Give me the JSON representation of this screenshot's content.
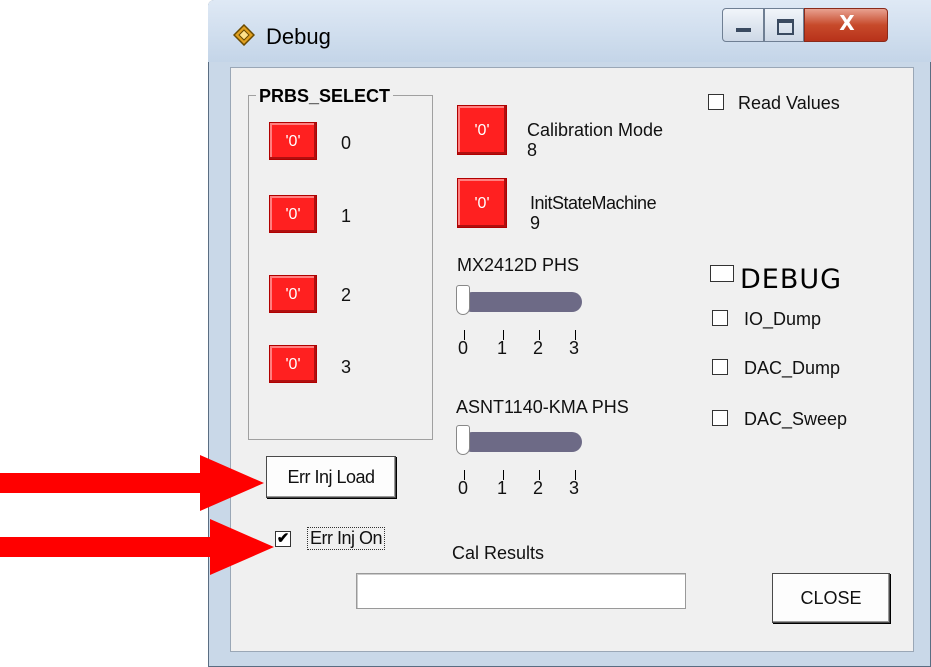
{
  "window": {
    "title": "Debug",
    "close_glyph": "X"
  },
  "prbs_select": {
    "label": "PRBS_SELECT",
    "items": [
      {
        "button_label": "'0'",
        "bit": "0"
      },
      {
        "button_label": "'0'",
        "bit": "1"
      },
      {
        "button_label": "'0'",
        "bit": "2"
      },
      {
        "button_label": "'0'",
        "bit": "3"
      }
    ]
  },
  "calibration": {
    "button_label": "'0'",
    "label": "Calibration Mode",
    "bit": "8"
  },
  "init_state": {
    "button_label": "'0'",
    "label": "InitStateMachine",
    "bit": "9"
  },
  "slider1": {
    "label": "MX2412D PHS",
    "value": 0,
    "ticks": [
      "0",
      "1",
      "2",
      "3"
    ]
  },
  "slider2": {
    "label": "ASNT1140-KMA PHS",
    "value": 0,
    "ticks": [
      "0",
      "1",
      "2",
      "3"
    ]
  },
  "read_values": {
    "label": "Read Values",
    "checked": false
  },
  "debug": {
    "label": "DEBUG",
    "checked": false,
    "options": [
      {
        "label": "IO_Dump",
        "checked": false
      },
      {
        "label": "DAC_Dump",
        "checked": false
      },
      {
        "label": "DAC_Sweep",
        "checked": false
      }
    ]
  },
  "err_inj_load": {
    "label": "Err Inj Load"
  },
  "err_inj_on": {
    "label": "Err Inj On",
    "checked": true,
    "check_glyph": "✔"
  },
  "cal_results": {
    "label": "Cal Results",
    "value": ""
  },
  "close_button": {
    "label": "CLOSE"
  },
  "colors": {
    "bit_button": "#ff2020",
    "arrow": "#ff0000",
    "slider_track": "#6d6a86"
  }
}
